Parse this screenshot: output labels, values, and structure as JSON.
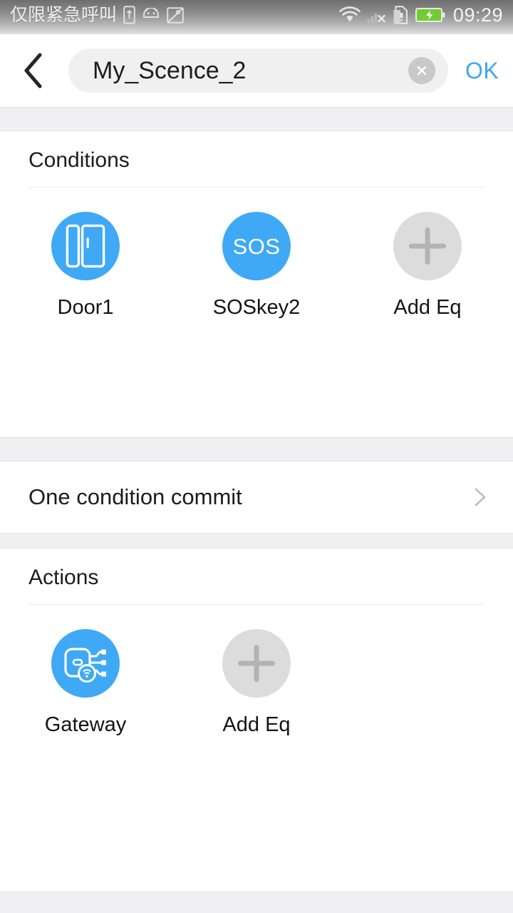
{
  "status_bar": {
    "carrier_text": "仅限紧急呼叫",
    "time": "09:29",
    "icons": [
      "sim-card-icon",
      "android-icon",
      "image-icon",
      "wifi-icon",
      "no-signal-icon",
      "sd-card-icon",
      "battery-charging-icon"
    ]
  },
  "topbar": {
    "back_icon": "chevron-left-icon",
    "scene_name": "My_Scence_2",
    "scene_name_placeholder": "Scene name",
    "clear_icon": "close-circle-icon",
    "ok_label": "OK"
  },
  "conditions": {
    "title": "Conditions",
    "items": [
      {
        "label": "Door1",
        "icon": "door-sensor-icon",
        "style": "blue"
      },
      {
        "label": "SOSkey2",
        "icon": "sos-icon",
        "style": "blue"
      },
      {
        "label": "Add Eq",
        "icon": "plus-icon",
        "style": "gray"
      }
    ]
  },
  "commit_row": {
    "label": "One condition commit",
    "chevron_icon": "chevron-right-icon"
  },
  "actions": {
    "title": "Actions",
    "items": [
      {
        "label": "Gateway",
        "icon": "gateway-icon",
        "style": "blue"
      },
      {
        "label": "Add Eq",
        "icon": "plus-icon",
        "style": "gray"
      }
    ]
  },
  "colors": {
    "accent_blue": "#3fa9f5",
    "link_blue": "#3fa5f5",
    "band_gray": "#f0f0f2",
    "circle_gray": "#dcdcdc",
    "battery_green": "#6fd22a"
  }
}
